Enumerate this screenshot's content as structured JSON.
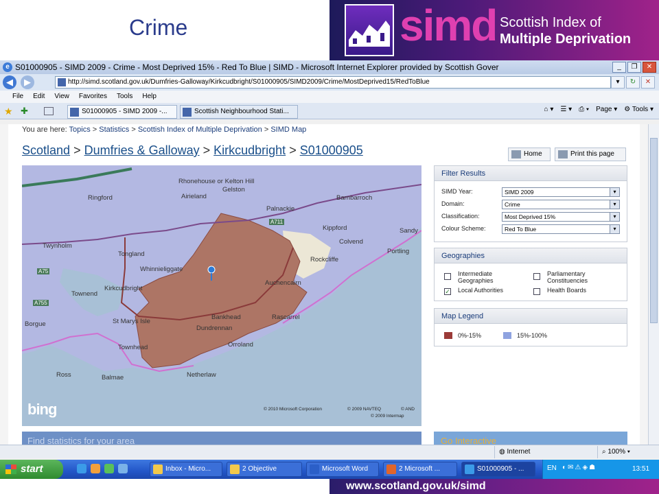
{
  "slide": {
    "title": "Crime",
    "brand": {
      "logo_text": "simd",
      "line1": "Scottish Index of",
      "line2": "Multiple Deprivation"
    },
    "footer_url": "www.scotland.gov.uk/simd"
  },
  "window": {
    "title": "S01000905 - SIMD 2009 - Crime - Most Deprived 15% - Red To Blue | SIMD - Microsoft Internet Explorer provided by Scottish Gover",
    "url": "http://simd.scotland.gov.uk/Dumfries-Galloway/Kirkcudbright/S01000905/SIMD2009/Crime/MostDeprived15/RedToBlue",
    "menu": [
      "File",
      "Edit",
      "View",
      "Favorites",
      "Tools",
      "Help"
    ],
    "tabs": [
      {
        "label": "S01000905 - SIMD 2009 -..."
      },
      {
        "label": "Scottish Neighbourhood Stati..."
      }
    ],
    "command_bar": {
      "page": "Page",
      "tools": "Tools"
    }
  },
  "page": {
    "you_are_here": "You are here:",
    "top_crumbs": [
      "Topics",
      "Statistics",
      "Scottish Index of Multiple Deprivation",
      "SIMD Map"
    ],
    "crumbs": [
      "Scotland",
      "Dumfries & Galloway",
      "Kirkcudbright",
      "S01000905"
    ],
    "home_label": "Home",
    "print_label": "Print this page",
    "filter": {
      "title": "Filter Results",
      "rows": [
        {
          "label": "SIMD Year:",
          "value": "SIMD 2009"
        },
        {
          "label": "Domain:",
          "value": "Crime"
        },
        {
          "label": "Classification:",
          "value": "Most Deprived 15%"
        },
        {
          "label": "Colour Scheme:",
          "value": "Red To Blue"
        }
      ]
    },
    "geographies": {
      "title": "Geographies",
      "items": [
        {
          "label": "Intermediate Geographies",
          "checked": false
        },
        {
          "label": "Parliamentary Constituencies",
          "checked": false
        },
        {
          "label": "Local Authorities",
          "checked": true
        },
        {
          "label": "Health Boards",
          "checked": false
        }
      ]
    },
    "legend": {
      "title": "Map Legend",
      "items": [
        {
          "label": "0%-15%",
          "color": "#9b3b38"
        },
        {
          "label": "15%-100%",
          "color": "#8fa3e0"
        }
      ]
    },
    "map": {
      "bing": "bing",
      "places": [
        "Rhonehouse or Kelton Hill",
        "Airieland",
        "Gelston",
        "Ringford",
        "Palnackie",
        "Barnbarroch",
        "Kippford",
        "Colvend",
        "Sandy",
        "Twynholm",
        "Tongland",
        "Rockcliffe",
        "Portling",
        "Whinnieliggate",
        "Auchencairn",
        "Townend",
        "Kirkcudbright",
        "Bankhead",
        "Rascarrel",
        "St Marys Isle",
        "Dundrennan",
        "Borgue",
        "Orroland",
        "Townhead",
        "Ross",
        "Balmae",
        "Netherlaw"
      ],
      "roads": [
        "A75",
        "A755",
        "A711"
      ],
      "copyright1": "© 2010 Microsoft Corporation",
      "copyright2": "© 2009 NAVTEQ",
      "copyright3": "© AND",
      "copyright4": "© 2009 Intermap"
    },
    "find_stats": "Find statistics for your area",
    "go_interactive": "Go Interactive"
  },
  "status": {
    "zone": "Internet",
    "zoom": "100%"
  },
  "taskbar": {
    "start": "start",
    "tasks": [
      "Inbox - Micro...",
      "2 Objective",
      "Microsoft Word",
      "2 Microsoft ...",
      "S01000905 - ..."
    ],
    "lang": "EN",
    "clock": "13:51"
  }
}
